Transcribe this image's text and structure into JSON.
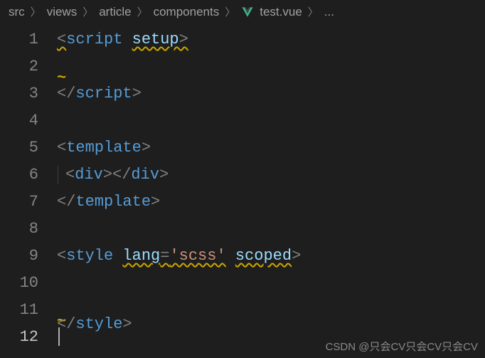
{
  "breadcrumb": {
    "items": [
      "src",
      "views",
      "article",
      "components",
      "test.vue",
      "..."
    ]
  },
  "editor": {
    "lines": [
      {
        "num": 1
      },
      {
        "num": 2
      },
      {
        "num": 3
      },
      {
        "num": 4
      },
      {
        "num": 5
      },
      {
        "num": 6
      },
      {
        "num": 7
      },
      {
        "num": 8
      },
      {
        "num": 9
      },
      {
        "num": 10
      },
      {
        "num": 11
      },
      {
        "num": 12
      }
    ],
    "tokens": {
      "script": "script",
      "setup": "setup",
      "template": "template",
      "div": "div",
      "style": "style",
      "lang": "lang",
      "scss": "'scss'",
      "scoped": "scoped",
      "lt": "<",
      "gt": ">",
      "ltc": "</",
      "eq": "="
    }
  },
  "watermark": "CSDN @只会CV只会CV只会CV"
}
